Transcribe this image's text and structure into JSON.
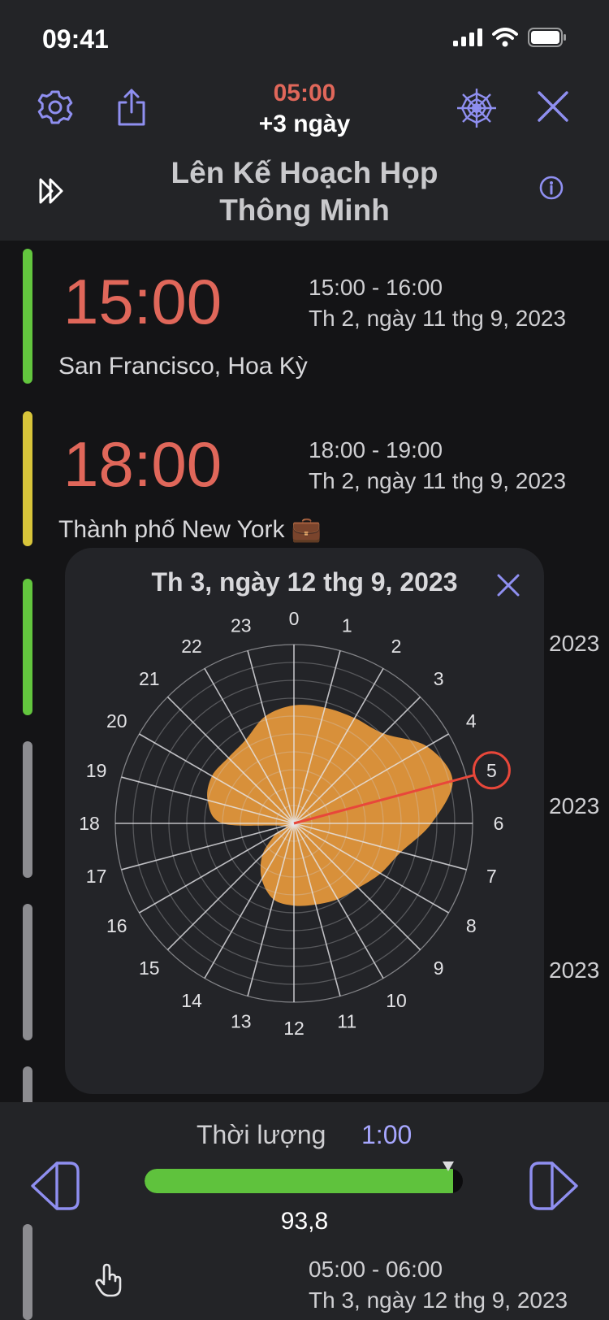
{
  "status_bar": {
    "time": "09:41"
  },
  "header": {
    "current_time": "05:00",
    "day_offset": "+3 ngày",
    "title_line1": "Lên Kế Hoạch Họp",
    "title_line2": "Thông Minh"
  },
  "entries": [
    {
      "big_time": "15:00",
      "range": "15:00 - 16:00",
      "date": "Th 2, ngày 11 thg 9, 2023",
      "location": "San Francisco, Hoa Kỳ",
      "bar_color": "#63c63e"
    },
    {
      "big_time": "18:00",
      "range": "18:00 - 19:00",
      "date": "Th 2, ngày 11 thg 9, 2023",
      "location": "Thành phố New York 💼",
      "bar_color": "#d8c53a"
    }
  ],
  "partially_hidden": {
    "year_fragments": [
      "2023",
      "2023",
      "2023"
    ],
    "bottom_range": "05:00 - 06:00",
    "bottom_date": "Th 3, ngày 12 thg 9, 2023"
  },
  "popup": {
    "title": "Th 3, ngày 12 thg 9, 2023",
    "hour_labels": [
      "0",
      "1",
      "2",
      "3",
      "4",
      "5",
      "6",
      "7",
      "8",
      "9",
      "10",
      "11",
      "12",
      "13",
      "14",
      "15",
      "16",
      "17",
      "18",
      "19",
      "20",
      "21",
      "22",
      "23"
    ],
    "selected_hour": 5,
    "radar_fill_color": "#e89a3c",
    "highlight_color": "#e8473a",
    "radar_values": [
      0.66,
      0.67,
      0.68,
      0.71,
      0.86,
      0.92,
      0.77,
      0.62,
      0.56,
      0.51,
      0.49,
      0.47,
      0.46,
      0.44,
      0.36,
      0.25,
      0.12,
      0.06,
      0.4,
      0.5,
      0.53,
      0.52,
      0.54,
      0.62
    ]
  },
  "footer": {
    "duration_label": "Thời lượng",
    "duration_value": "1:00",
    "progress_fraction": 0.97,
    "score": "93,8"
  },
  "colors": {
    "accent": "#8f8ff0",
    "time_red": "#e0675a",
    "background": "#141416",
    "panel": "#232427"
  }
}
